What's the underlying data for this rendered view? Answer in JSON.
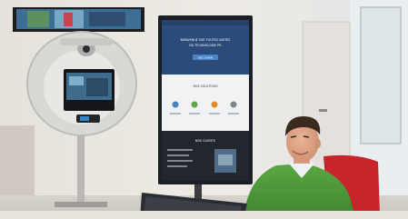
{
  "image": {
    "kind": "photograph",
    "subject": "office lobby with a telepresence robot kiosk, a vertical digital signage screen and a smiling man at a desk monitor",
    "colors": {
      "wall": "#ece8e2",
      "screen_dark": "#1b1e24",
      "signage_header": "#2b4b7a",
      "robot_ring": "#d9d9d6",
      "sweater": "#4f9a3a",
      "chair": "#c7242b",
      "shirt": "#eef2f6",
      "skin": "#e0a888",
      "hair": "#3a2a1e"
    }
  },
  "signage": {
    "hero_line1": "BIENVENUE SUR TOUTES VISITES",
    "hero_line2": "DU TECHNOLOGIE PR",
    "hero_button": "DÉCOUVRIR",
    "section1_title": "NOS SOLUTIONS",
    "section2_title": "NOS CLIENTS"
  }
}
